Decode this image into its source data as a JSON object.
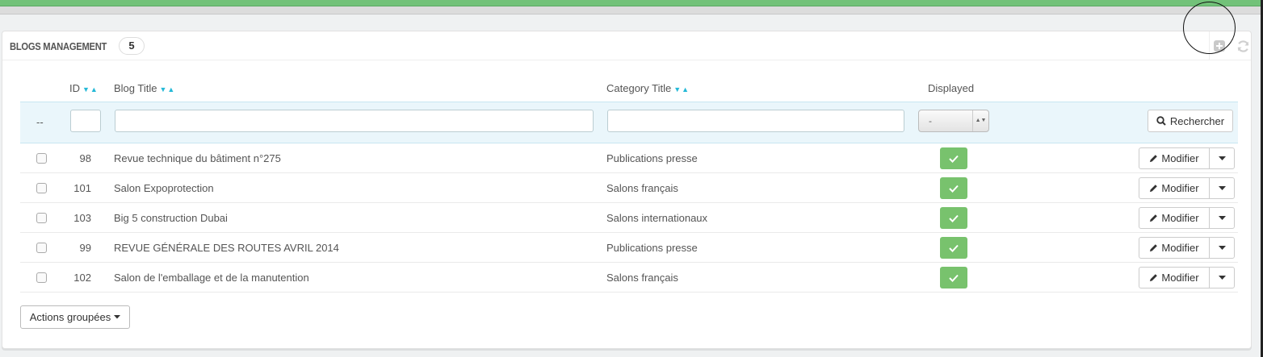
{
  "panel": {
    "title": "BLOGS MANAGEMENT",
    "count": "5"
  },
  "toolbar": {
    "add_icon": "plus-square-icon",
    "refresh_icon": "refresh-icon"
  },
  "columns": {
    "id": "ID",
    "blog_title": "Blog Title",
    "category_title": "Category Title",
    "displayed": "Displayed"
  },
  "filters": {
    "dash": "--",
    "id_value": "",
    "blog_title_value": "",
    "category_title_value": "",
    "displayed_value": "-",
    "search_label": "Rechercher"
  },
  "rows": [
    {
      "id": "98",
      "blog_title": "Revue technique du bâtiment n°275",
      "category": "Publications presse",
      "displayed": true,
      "edit_label": "Modifier"
    },
    {
      "id": "101",
      "blog_title": "Salon Expoprotection",
      "category": "Salons français",
      "displayed": true,
      "edit_label": "Modifier"
    },
    {
      "id": "103",
      "blog_title": "Big 5 construction Dubai",
      "category": "Salons internationaux",
      "displayed": true,
      "edit_label": "Modifier"
    },
    {
      "id": "99",
      "blog_title": "REVUE GÉNÉRALE DES ROUTES AVRIL 2014",
      "category": "Publications presse",
      "displayed": true,
      "edit_label": "Modifier"
    },
    {
      "id": "102",
      "blog_title": "Salon de l'emballage et de la manutention",
      "category": "Salons français",
      "displayed": true,
      "edit_label": "Modifier"
    }
  ],
  "bulk_actions_label": "Actions groupées",
  "colors": {
    "accent_green": "#78c26d",
    "sort_arrow_blue": "#25b9d7",
    "filter_row_bg": "#eaf6fb"
  }
}
